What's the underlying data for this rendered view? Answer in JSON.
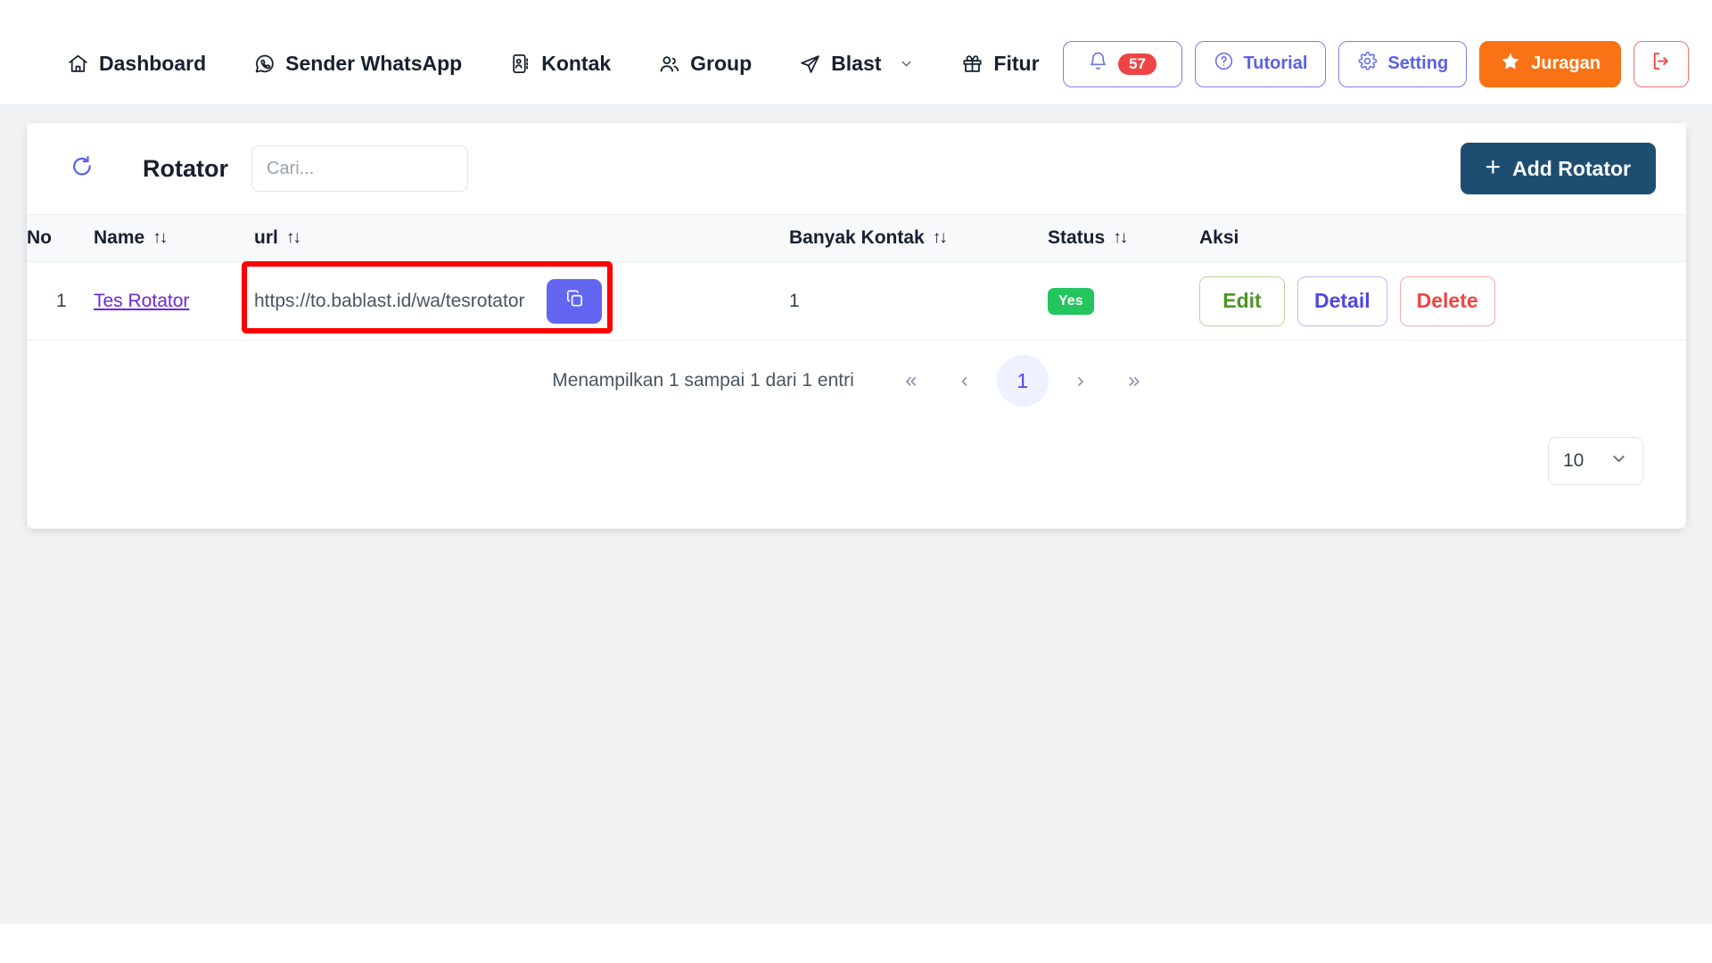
{
  "navbar": {
    "items": [
      {
        "label": "Dashboard",
        "icon": "home-icon",
        "has_chevron": false
      },
      {
        "label": "Sender WhatsApp",
        "icon": "whatsapp-icon",
        "has_chevron": false
      },
      {
        "label": "Kontak",
        "icon": "contact-card-icon",
        "has_chevron": false
      },
      {
        "label": "Group",
        "icon": "users-icon",
        "has_chevron": false
      },
      {
        "label": "Blast",
        "icon": "send-icon",
        "has_chevron": true
      },
      {
        "label": "Fitur",
        "icon": "gift-icon",
        "has_chevron": false
      }
    ],
    "notification": {
      "icon": "bell-icon",
      "count": "57"
    },
    "tutorial": {
      "label": "Tutorial",
      "icon": "question-circle-icon"
    },
    "setting": {
      "label": "Setting",
      "icon": "gear-icon"
    },
    "juragan": {
      "label": "Juragan",
      "icon": "star-icon"
    },
    "logout": {
      "icon": "logout-icon"
    }
  },
  "card": {
    "refresh_icon": "refresh-icon",
    "title": "Rotator",
    "search": {
      "value": "",
      "placeholder": "Cari..."
    },
    "add_button": {
      "label": "Add Rotator",
      "plus": "+"
    }
  },
  "table": {
    "columns": [
      {
        "label": "No",
        "sortable": false
      },
      {
        "label": "Name",
        "sortable": true,
        "sort_icon": "↑↓"
      },
      {
        "label": "url",
        "sortable": true,
        "sort_icon": "↑↓"
      },
      {
        "label": "Banyak Kontak",
        "sortable": true,
        "sort_icon": "↑↓"
      },
      {
        "label": "Status",
        "sortable": true,
        "sort_icon": "↑↓"
      },
      {
        "label": "Aksi",
        "sortable": false
      }
    ],
    "rows": [
      {
        "no": "1",
        "name": "Tes Rotator",
        "url": "https://to.bablast.id/wa/tesrotator",
        "copy_icon": "copy-icon",
        "banyak_kontak": "1",
        "status": "Yes",
        "actions": [
          {
            "label": "Edit"
          },
          {
            "label": "Detail"
          },
          {
            "label": "Delete"
          }
        ]
      }
    ]
  },
  "pagination": {
    "info": "Menampilkan 1 sampai 1 dari 1 entri",
    "first": "«",
    "prev": "‹",
    "current_page": "1",
    "next": "›",
    "last": "»"
  },
  "page_size": {
    "value": "10",
    "chevron": "chevron-down-icon"
  },
  "colors": {
    "accent_indigo": "#6366f1",
    "brand_dark_blue": "#1d4e72",
    "orange": "#f97316",
    "success_green": "#22c55e",
    "danger_red": "#ef4444",
    "highlight_red": "#ff0000",
    "page_bg": "#f1f2f4"
  }
}
